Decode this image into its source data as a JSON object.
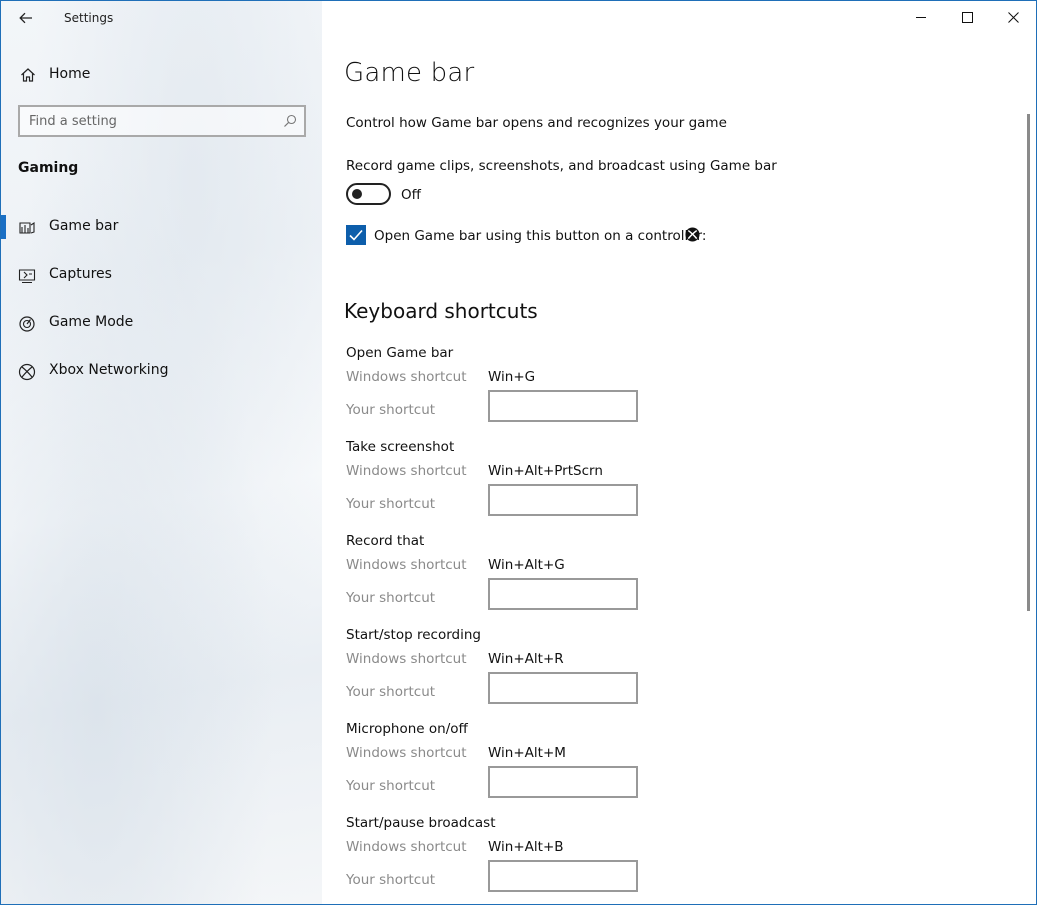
{
  "window": {
    "title": "Settings"
  },
  "sidebar": {
    "home_label": "Home",
    "search_placeholder": "Find a setting",
    "section_title": "Gaming",
    "items": [
      {
        "label": "Game bar",
        "icon": "game-bar-icon",
        "selected": true
      },
      {
        "label": "Captures",
        "icon": "captures-icon",
        "selected": false
      },
      {
        "label": "Game Mode",
        "icon": "game-mode-icon",
        "selected": false
      },
      {
        "label": "Xbox Networking",
        "icon": "xbox-icon",
        "selected": false
      }
    ]
  },
  "main": {
    "title": "Game bar",
    "description": "Control how Game bar opens and recognizes your game",
    "toggle_label": "Record game clips, screenshots, and broadcast using Game bar",
    "toggle_state": "Off",
    "checkbox_label": "Open Game bar using this button on a controller:",
    "checkbox_checked": true,
    "shortcuts_heading": "Keyboard shortcuts",
    "windows_shortcut_label": "Windows shortcut",
    "your_shortcut_label": "Your shortcut",
    "shortcuts": [
      {
        "title": "Open Game bar",
        "windows": "Win+G",
        "yours": ""
      },
      {
        "title": "Take screenshot",
        "windows": "Win+Alt+PrtScrn",
        "yours": ""
      },
      {
        "title": "Record that",
        "windows": "Win+Alt+G",
        "yours": ""
      },
      {
        "title": "Start/stop recording",
        "windows": "Win+Alt+R",
        "yours": ""
      },
      {
        "title": "Microphone on/off",
        "windows": "Win+Alt+M",
        "yours": ""
      },
      {
        "title": "Start/pause broadcast",
        "windows": "Win+Alt+B",
        "yours": ""
      }
    ]
  },
  "colors": {
    "accent": "#0d5eab",
    "selection_bar": "#1a6fc4",
    "muted_text": "#8a8a8a"
  }
}
